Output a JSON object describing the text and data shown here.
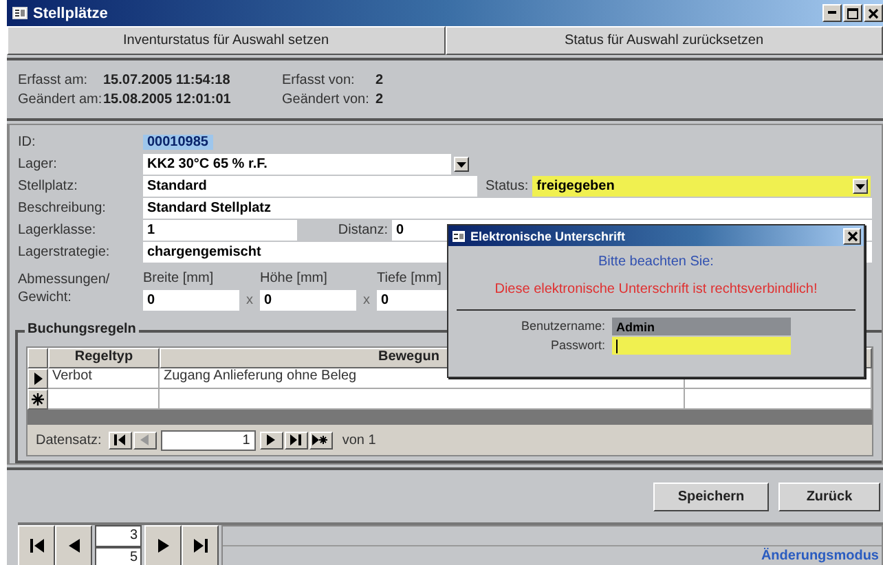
{
  "window": {
    "title": "Stellplätze"
  },
  "toolbar_buttons": [
    "Inventurstatus für Auswahl setzen",
    "Status für Auswahl zurücksetzen"
  ],
  "audit": [
    {
      "label": "Erfasst am:",
      "value": "15.07.2005 11:54:18",
      "by_label": "Erfasst von:",
      "by_value": "2"
    },
    {
      "label": "Geändert am:",
      "value": "15.08.2005 12:01:01",
      "by_label": "Geändert von:",
      "by_value": "2"
    }
  ],
  "form": {
    "id": {
      "label": "ID:",
      "value": "00010985",
      "selected": true
    },
    "lager": {
      "label": "Lager:",
      "value": "KK2 30°C 65 % r.F."
    },
    "stellplatz": {
      "label": "Stellplatz:",
      "value": "Standard"
    },
    "status": {
      "label": "Status:",
      "value": "freigegeben"
    },
    "beschreibung": {
      "label": "Beschreibung:",
      "value": "Standard Stellplatz"
    },
    "lagerklasse": {
      "label": "Lagerklasse:",
      "value": "1"
    },
    "distanz": {
      "label": "Distanz:",
      "value": "0"
    },
    "lagerstrategie": {
      "label": "Lagerstrategie:",
      "value": "chargengemischt"
    },
    "dimensions": {
      "label": "Abmessungen/ Gewicht:",
      "fields": [
        {
          "label": "Breite [mm]",
          "value": "0"
        },
        {
          "label": "Höhe [mm]",
          "value": "0"
        },
        {
          "label": "Tiefe [mm]",
          "value": "0"
        }
      ],
      "separators": [
        "x",
        "x"
      ]
    }
  },
  "booking_rules": {
    "title": "Buchungsregeln",
    "columns": [
      "Regeltyp",
      "Bewegun"
    ],
    "rows": [
      {
        "kind": "current",
        "cells": [
          "Verbot",
          "Zugang Anlieferung ohne Beleg"
        ]
      },
      {
        "kind": "new",
        "cells": [
          "",
          ""
        ]
      }
    ],
    "navigator": {
      "label": "Datensatz:",
      "value": "1",
      "total": "von 1"
    }
  },
  "buttons": [
    "Speichern",
    "Zurück"
  ],
  "record_nav": {
    "current": "3",
    "total": "5",
    "mode": "Änderungsmodus"
  },
  "dialog": {
    "title": "Elektronische Unterschrift",
    "heading": "Bitte beachten Sie:",
    "warning": "Diese elektronische Unterschrift ist rechtsverbindlich!",
    "fields": [
      {
        "label": "Benutzername:",
        "value": "Admin",
        "focused": false
      },
      {
        "label": "Passwort:",
        "focused": true
      }
    ]
  }
}
